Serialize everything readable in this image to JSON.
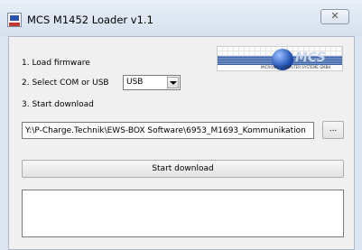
{
  "window": {
    "title": "MCS M1452 Loader v1.1",
    "close_glyph": "✕"
  },
  "steps": {
    "load_firmware": "1. Load firmware",
    "select_port": "2. Select COM or USB",
    "start_download": "3. Start download"
  },
  "port_select": {
    "value": "USB"
  },
  "firmware_path": {
    "value": "Y:\\P-Charge.Technik\\EWS-BOX Software\\6953_M1693_Kommunikation"
  },
  "buttons": {
    "browse": "...",
    "start_download": "Start download"
  },
  "logo": {
    "wordmark": "MCS",
    "caption": "MICRONIC COMPUTER SYSTEME GMBH"
  },
  "log": {
    "text": ""
  }
}
